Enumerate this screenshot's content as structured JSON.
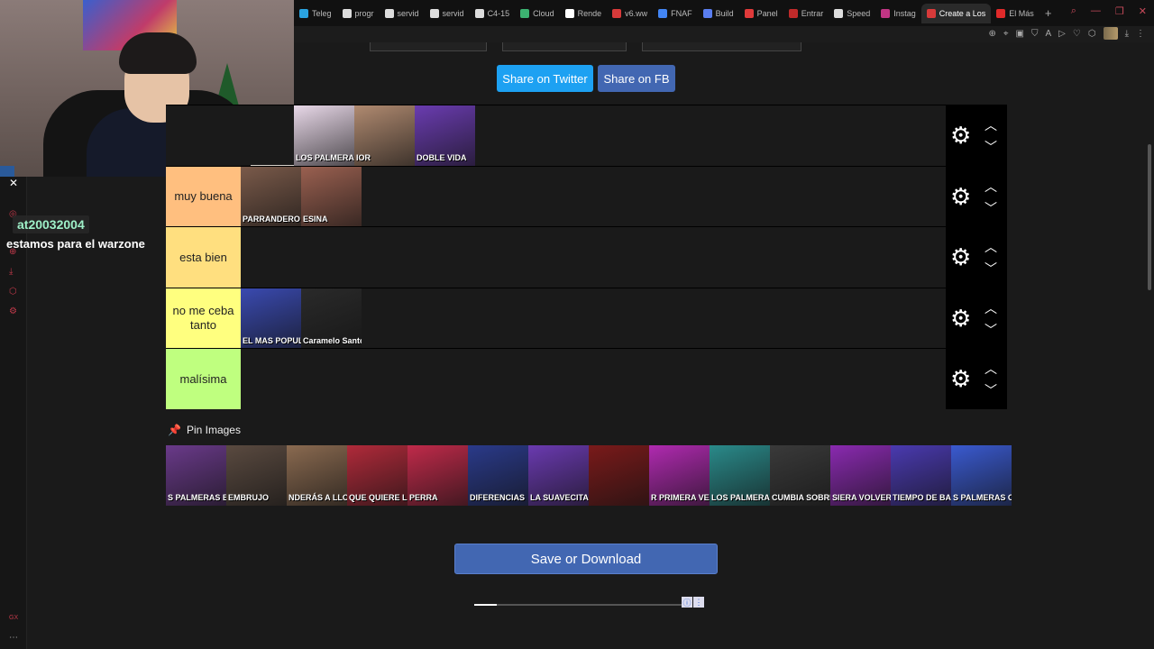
{
  "browser": {
    "tabs": [
      {
        "label": "Teleg",
        "color": "#2aa3e0"
      },
      {
        "label": "progr",
        "color": "#dddddd"
      },
      {
        "label": "servid",
        "color": "#dddddd"
      },
      {
        "label": "servid",
        "color": "#dddddd"
      },
      {
        "label": "C4-15",
        "color": "#dddddd"
      },
      {
        "label": "Cloud",
        "color": "#3cb371"
      },
      {
        "label": "Rende",
        "color": "#ffffff"
      },
      {
        "label": "v6.ww",
        "color": "#d83a3a"
      },
      {
        "label": "FNAF",
        "color": "#4285f4"
      },
      {
        "label": "Build",
        "color": "#5a7ef0"
      },
      {
        "label": "Panel",
        "color": "#e03a3a"
      },
      {
        "label": "Entrar",
        "color": "#c02a2a"
      },
      {
        "label": "Speed",
        "color": "#dddddd"
      },
      {
        "label": "Instag",
        "color": "#c13584"
      },
      {
        "label": "Create a Los",
        "color": "#d83a3a",
        "active": true
      },
      {
        "label": "El Más",
        "color": "#e02a2a"
      }
    ],
    "new_tab": "+"
  },
  "chat": {
    "username": "at20032004",
    "message": "estamos para el warzone"
  },
  "share": {
    "twitter": "Share on Twitter",
    "facebook": "Share on FB"
  },
  "tiers": [
    {
      "label": "",
      "color": "#1a1a1a",
      "items": [
        {
          "caption": "LOS PALMERAS EL BOMBON",
          "bg": "#e8d8e8"
        },
        {
          "caption": "IOR",
          "bg": "#b08a70"
        },
        {
          "caption": "DOBLE VIDA",
          "bg": "#6a3cb0"
        }
      ]
    },
    {
      "label": "muy buena",
      "color": "#ffbf7f",
      "items": [
        {
          "caption": "PARRANDERO",
          "bg": "#7a5a4a"
        },
        {
          "caption": "ESINA",
          "bg": "#9a6050"
        }
      ]
    },
    {
      "label": "esta bien",
      "color": "#ffdf7f",
      "items": []
    },
    {
      "label": "no me ceba tanto",
      "color": "#ffff7f",
      "items": [
        {
          "caption": "EL MAS POPULAR",
          "bg": "#3a4ab0"
        },
        {
          "caption": "Caramelo Santo",
          "bg": "#2a2a2a"
        }
      ]
    },
    {
      "label": "malísima",
      "color": "#bfff7f",
      "items": []
    }
  ],
  "pin": {
    "label": "Pin Images",
    "items": [
      {
        "caption": "S PALMERAS BESTIA POP",
        "bg": "#6a3a8a"
      },
      {
        "caption": "EMBRUJO",
        "bg": "#5a4a40"
      },
      {
        "caption": "NDERÁS A LLOR",
        "bg": "#8a6a50"
      },
      {
        "caption": "QUE QUIERE LA CHOLA",
        "bg": "#b02a3a"
      },
      {
        "caption": "PERRA",
        "bg": "#c02a4a"
      },
      {
        "caption": "DIFERENCIAS",
        "bg": "#2a3a8a"
      },
      {
        "caption": "LA SUAVECITA",
        "bg": "#6a3ab0"
      },
      {
        "caption": "",
        "bg": "#7a1a1a"
      },
      {
        "caption": "R PRIMERA VEZ",
        "bg": "#b02ab0"
      },
      {
        "caption": "LOS PALMERAS",
        "bg": "#2a8a8a"
      },
      {
        "caption": "CUMBIA SOBRE EL MAR",
        "bg": "#3a3a3a"
      },
      {
        "caption": "SIERA VOLVER",
        "bg": "#8a2ab0"
      },
      {
        "caption": "TIEMPO DE BAIL",
        "bg": "#4a3ab0"
      },
      {
        "caption": "S PALMERAS CHACHA TRISTE",
        "bg": "#3a5ad0"
      }
    ]
  },
  "save_label": "Save or Download",
  "progress": 0.11
}
